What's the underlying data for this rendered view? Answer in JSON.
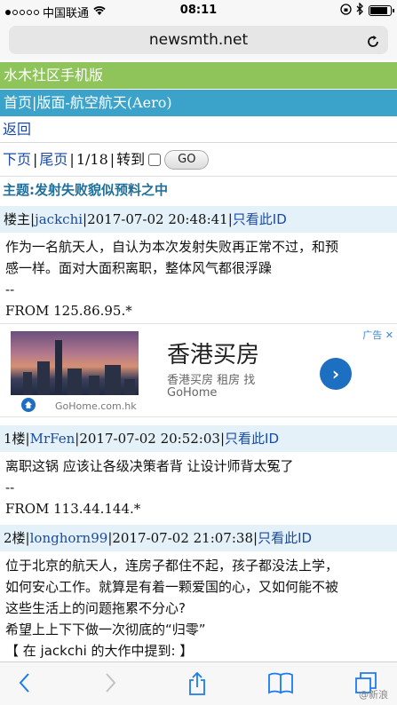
{
  "status": {
    "carrier": "中国联通",
    "time": "08:11",
    "battery_level": 0.85
  },
  "browser": {
    "url": "newsmth.net"
  },
  "site": {
    "title": "水木社区手机版",
    "breadcrumb_home": "首页",
    "breadcrumb_board": "版面-航空航天(Aero)",
    "back": "返回"
  },
  "pager": {
    "next": "下页",
    "last": "尾页",
    "page": "1/18",
    "goto": "转到",
    "go_button": "GO"
  },
  "topic": {
    "title": "主题:发射失败貌似预料之中"
  },
  "posts": [
    {
      "floor": "楼主",
      "author": "jackchi",
      "time": "2017-07-02 20:48:41",
      "only": "只看此ID",
      "lines": [
        "作为一名航天人，自认为本次发射失败再正常不过，和预",
        "感一样。面对大面积离职，整体风气都很浮躁"
      ],
      "dash": "--",
      "from": "FROM 125.86.95.*"
    },
    {
      "floor": "1楼",
      "author": "MrFen",
      "time": "2017-07-02 20:52:03",
      "only": "只看此ID",
      "lines": [
        "离职这锅 应该让各级决策者背 让设计师背太冤了"
      ],
      "dash": "--",
      "from": "FROM 113.44.144.*"
    },
    {
      "floor": "2楼",
      "author": "longhorn99",
      "time": "2017-07-02 21:07:38",
      "only": "只看此ID",
      "lines": [
        "位于北京的航天人，连房子都住不起，孩子都没法上学，",
        "如何安心工作。就算是有着一颗爱国的心，又如何能不被",
        "这些生活上的问题拖累不分心?",
        "希望上上下下做一次彻底的“归零”",
        "【 在 jackchi 的大作中提到: 】"
      ]
    }
  ],
  "ad": {
    "title": "香港买房",
    "subtitle": "香港买房 租房 找",
    "brand": "GoHome",
    "badge": "广告 ✕",
    "domain": "GoHome.com.hk"
  },
  "watermark": "@新浪",
  "colors": {
    "site_bar": "#8fc45a",
    "breadcrumb_bar": "#3ba2c9",
    "link": "#1a4aa8",
    "post_head_bg": "#e5f1f8",
    "ios_blue": "#1b7bf0"
  }
}
